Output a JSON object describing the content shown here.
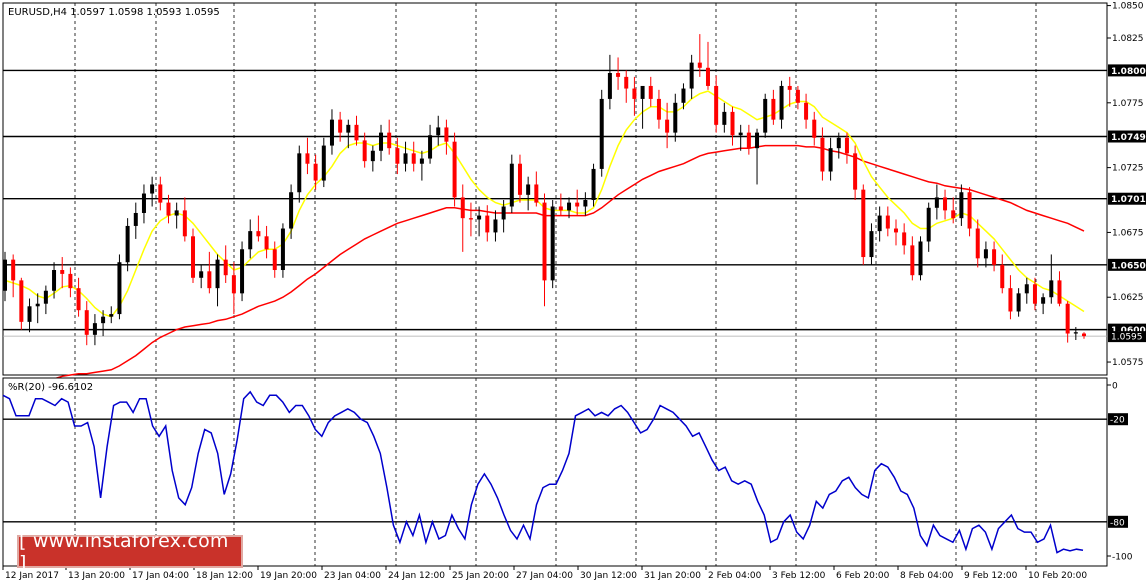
{
  "chart_data": {
    "type": "candlestick",
    "main": {
      "title": "EURUSD,H4  1.0597 1.0598 1.0593 1.0595",
      "ylim": [
        1.0565,
        1.0852
      ],
      "y_ticks": [
        "1.0850",
        "1.0825",
        "1.0775",
        "1.0725",
        "1.0675",
        "1.0625",
        "1.0575"
      ],
      "level_labels": [
        "1.0800",
        "1.0749",
        "1.0701",
        "1.0650",
        "1.0600"
      ],
      "last_price_label": "1.0595",
      "up_color": "#000000",
      "down_color": "#ff0000",
      "ma_fast_color": "#ffff00",
      "ma_slow_color": "#ff0000",
      "candles": [
        [
          1.063,
          1.066,
          1.0622,
          1.0654
        ],
        [
          1.0654,
          1.0658,
          1.0625,
          1.0638
        ],
        [
          1.0638,
          1.064,
          1.06,
          1.0606
        ],
        [
          1.0606,
          1.0624,
          1.0598,
          1.0618
        ],
        [
          1.0618,
          1.0628,
          1.0605,
          1.062
        ],
        [
          1.062,
          1.0634,
          1.0612,
          1.063
        ],
        [
          1.063,
          1.0652,
          1.0624,
          1.0646
        ],
        [
          1.0646,
          1.0656,
          1.0632,
          1.0643
        ],
        [
          1.0643,
          1.0648,
          1.0625,
          1.0632
        ],
        [
          1.0632,
          1.064,
          1.061,
          1.0615
        ],
        [
          1.0615,
          1.0622,
          1.0588,
          1.0596
        ],
        [
          1.0596,
          1.0612,
          1.0588,
          1.0605
        ],
        [
          1.0605,
          1.0615,
          1.0595,
          1.061
        ],
        [
          1.061,
          1.0618,
          1.0605,
          1.0612
        ],
        [
          1.0612,
          1.0658,
          1.0608,
          1.0652
        ],
        [
          1.0652,
          1.0686,
          1.0645,
          1.068
        ],
        [
          1.068,
          1.0698,
          1.067,
          1.069
        ],
        [
          1.069,
          1.0712,
          1.0682,
          1.0705
        ],
        [
          1.0705,
          1.0718,
          1.0695,
          1.0712
        ],
        [
          1.0712,
          1.0718,
          1.0692,
          1.0698
        ],
        [
          1.0698,
          1.0704,
          1.0682,
          1.0688
        ],
        [
          1.0688,
          1.0698,
          1.0678,
          1.0692
        ],
        [
          1.0692,
          1.0702,
          1.0668,
          1.0672
        ],
        [
          1.0672,
          1.0678,
          1.0636,
          1.064
        ],
        [
          1.064,
          1.065,
          1.0632,
          1.0645
        ],
        [
          1.0645,
          1.066,
          1.0628,
          1.0632
        ],
        [
          1.0632,
          1.0658,
          1.0618,
          1.0654
        ],
        [
          1.0654,
          1.0665,
          1.0636,
          1.0642
        ],
        [
          1.0642,
          1.0652,
          1.0612,
          1.0628
        ],
        [
          1.0628,
          1.0668,
          1.0622,
          1.0662
        ],
        [
          1.0662,
          1.0685,
          1.0655,
          1.0676
        ],
        [
          1.0676,
          1.0688,
          1.0668,
          1.0672
        ],
        [
          1.0672,
          1.068,
          1.0655,
          1.0662
        ],
        [
          1.0662,
          1.0668,
          1.064,
          1.0646
        ],
        [
          1.0646,
          1.0682,
          1.064,
          1.0678
        ],
        [
          1.0678,
          1.0712,
          1.067,
          1.0706
        ],
        [
          1.0706,
          1.0742,
          1.0698,
          1.0736
        ],
        [
          1.0736,
          1.0748,
          1.072,
          1.0728
        ],
        [
          1.0728,
          1.0735,
          1.0708,
          1.0715
        ],
        [
          1.0715,
          1.0748,
          1.071,
          1.0742
        ],
        [
          1.0742,
          1.077,
          1.0735,
          1.0762
        ],
        [
          1.0762,
          1.0768,
          1.0745,
          1.0752
        ],
        [
          1.0752,
          1.0762,
          1.074,
          1.0758
        ],
        [
          1.0758,
          1.0765,
          1.0742,
          1.0746
        ],
        [
          1.0746,
          1.0752,
          1.0725,
          1.073
        ],
        [
          1.073,
          1.0742,
          1.0722,
          1.0738
        ],
        [
          1.0738,
          1.0758,
          1.073,
          1.0752
        ],
        [
          1.0752,
          1.0762,
          1.0735,
          1.074
        ],
        [
          1.074,
          1.0748,
          1.072,
          1.0728
        ],
        [
          1.0728,
          1.0745,
          1.0722,
          1.0736
        ],
        [
          1.0736,
          1.0745,
          1.0722,
          1.0728
        ],
        [
          1.0728,
          1.0738,
          1.0715,
          1.0732
        ],
        [
          1.0732,
          1.0758,
          1.0728,
          1.075
        ],
        [
          1.075,
          1.0765,
          1.0742,
          1.0756
        ],
        [
          1.0756,
          1.0762,
          1.0735,
          1.0745
        ],
        [
          1.0745,
          1.0752,
          1.0695,
          1.0702
        ],
        [
          1.0702,
          1.0712,
          1.066,
          1.0686
        ],
        [
          1.0686,
          1.0698,
          1.0672,
          1.0685
        ],
        [
          1.0685,
          1.0695,
          1.0672,
          1.0688
        ],
        [
          1.0688,
          1.0696,
          1.0668,
          1.0675
        ],
        [
          1.0675,
          1.0692,
          1.0668,
          1.0685
        ],
        [
          1.0685,
          1.07,
          1.0675,
          1.0695
        ],
        [
          1.0695,
          1.0735,
          1.069,
          1.0728
        ],
        [
          1.0728,
          1.0735,
          1.0698,
          1.0704
        ],
        [
          1.0704,
          1.0718,
          1.0692,
          1.0712
        ],
        [
          1.0712,
          1.0722,
          1.0695,
          1.0698
        ],
        [
          1.0698,
          1.0705,
          1.0618,
          1.0638
        ],
        [
          1.0638,
          1.07,
          1.0632,
          1.0695
        ],
        [
          1.0695,
          1.0705,
          1.0688,
          1.0692
        ],
        [
          1.0692,
          1.0702,
          1.0686,
          1.0698
        ],
        [
          1.0698,
          1.0708,
          1.0688,
          1.0695
        ],
        [
          1.0695,
          1.0706,
          1.0688,
          1.07
        ],
        [
          1.07,
          1.0728,
          1.0695,
          1.0724
        ],
        [
          1.0724,
          1.0785,
          1.0718,
          1.0778
        ],
        [
          1.0778,
          1.0812,
          1.077,
          1.0798
        ],
        [
          1.0798,
          1.081,
          1.0785,
          1.0795
        ],
        [
          1.0795,
          1.08,
          1.0775,
          1.0786
        ],
        [
          1.0786,
          1.0795,
          1.0765,
          1.0778
        ],
        [
          1.0778,
          1.0785,
          1.0755,
          1.0788
        ],
        [
          1.0788,
          1.0795,
          1.0772,
          1.0778
        ],
        [
          1.0778,
          1.0785,
          1.0755,
          1.0762
        ],
        [
          1.0762,
          1.0775,
          1.074,
          1.0752
        ],
        [
          1.0752,
          1.0782,
          1.0745,
          1.0775
        ],
        [
          1.0775,
          1.079,
          1.077,
          1.0786
        ],
        [
          1.0786,
          1.0812,
          1.0778,
          1.0806
        ],
        [
          1.0806,
          1.0828,
          1.0795,
          1.0802
        ],
        [
          1.0802,
          1.0822,
          1.0785,
          1.0788
        ],
        [
          1.0788,
          1.0796,
          1.0752,
          1.0758
        ],
        [
          1.0758,
          1.0775,
          1.0752,
          1.0768
        ],
        [
          1.0768,
          1.0772,
          1.0742,
          1.075
        ],
        [
          1.075,
          1.0758,
          1.0738,
          1.0752
        ],
        [
          1.0752,
          1.0758,
          1.0735,
          1.074
        ],
        [
          1.074,
          1.0755,
          1.0712,
          1.0752
        ],
        [
          1.0752,
          1.0782,
          1.0748,
          1.0778
        ],
        [
          1.0778,
          1.0785,
          1.0758,
          1.0762
        ],
        [
          1.0762,
          1.0792,
          1.0755,
          1.0788
        ],
        [
          1.0788,
          1.0795,
          1.0772,
          1.0785
        ],
        [
          1.0785,
          1.0788,
          1.077,
          1.0775
        ],
        [
          1.0775,
          1.0782,
          1.0755,
          1.0762
        ],
        [
          1.0762,
          1.0768,
          1.0742,
          1.0748
        ],
        [
          1.0748,
          1.0756,
          1.0715,
          1.0722
        ],
        [
          1.0722,
          1.0748,
          1.0715,
          1.074
        ],
        [
          1.074,
          1.0752,
          1.0732,
          1.0748
        ],
        [
          1.0748,
          1.0752,
          1.0728,
          1.0736
        ],
        [
          1.0736,
          1.0742,
          1.07,
          1.0708
        ],
        [
          1.0708,
          1.0712,
          1.065,
          1.0656
        ],
        [
          1.0656,
          1.0682,
          1.065,
          1.0676
        ],
        [
          1.0676,
          1.0695,
          1.0668,
          1.0688
        ],
        [
          1.0688,
          1.0695,
          1.0672,
          1.0678
        ],
        [
          1.0678,
          1.0685,
          1.0665,
          1.0675
        ],
        [
          1.0675,
          1.0682,
          1.0658,
          1.0665
        ],
        [
          1.0665,
          1.0672,
          1.0638,
          1.0642
        ],
        [
          1.0642,
          1.0672,
          1.0638,
          1.0668
        ],
        [
          1.0668,
          1.0698,
          1.066,
          1.0694
        ],
        [
          1.0694,
          1.0712,
          1.0685,
          1.0702
        ],
        [
          1.0702,
          1.0708,
          1.0685,
          1.0692
        ],
        [
          1.0692,
          1.0702,
          1.0682,
          1.0686
        ],
        [
          1.0686,
          1.0712,
          1.068,
          1.0706
        ],
        [
          1.0706,
          1.071,
          1.0672,
          1.0678
        ],
        [
          1.0678,
          1.0685,
          1.0648,
          1.0655
        ],
        [
          1.0655,
          1.0668,
          1.0648,
          1.0662
        ],
        [
          1.0662,
          1.0668,
          1.0645,
          1.065
        ],
        [
          1.065,
          1.0658,
          1.0628,
          1.0632
        ],
        [
          1.0632,
          1.0642,
          1.0608,
          1.0614
        ],
        [
          1.0614,
          1.0632,
          1.061,
          1.0628
        ],
        [
          1.0628,
          1.064,
          1.062,
          1.0635
        ],
        [
          1.0635,
          1.064,
          1.0615,
          1.062
        ],
        [
          1.062,
          1.0628,
          1.0612,
          1.0625
        ],
        [
          1.0625,
          1.0658,
          1.062,
          1.0638
        ],
        [
          1.0638,
          1.0645,
          1.0618,
          1.062
        ],
        [
          1.062,
          1.0622,
          1.059,
          1.0597
        ],
        [
          1.0597,
          1.0602,
          1.0592,
          1.0598
        ],
        [
          1.0597,
          1.0598,
          1.0593,
          1.0595
        ]
      ],
      "ma_fast": [
        1.0638,
        1.0636,
        1.0634,
        1.0631,
        1.0626,
        1.0624,
        1.0628,
        1.0633,
        1.0634,
        1.063,
        1.0624,
        1.0617,
        1.0612,
        1.061,
        1.0618,
        1.063,
        1.0646,
        1.0662,
        1.0676,
        1.0684,
        1.0688,
        1.069,
        1.0688,
        1.0682,
        1.0674,
        1.0666,
        1.0658,
        1.0652,
        1.0646,
        1.0648,
        1.0654,
        1.066,
        1.0662,
        1.0662,
        1.0666,
        1.0676,
        1.0692,
        1.0704,
        1.0712,
        1.0718,
        1.0726,
        1.0736,
        1.0742,
        1.0744,
        1.0744,
        1.0742,
        1.0744,
        1.0744,
        1.0742,
        1.074,
        1.0738,
        1.0736,
        1.0738,
        1.0742,
        1.0744,
        1.0736,
        1.0726,
        1.0716,
        1.0708,
        1.0702,
        1.0698,
        1.0696,
        1.0698,
        1.07,
        1.07,
        1.07,
        1.0694,
        1.0692,
        1.0692,
        1.0692,
        1.069,
        1.069,
        1.0694,
        1.0708,
        1.0726,
        1.0742,
        1.0754,
        1.0762,
        1.0768,
        1.0772,
        1.0772,
        1.0768,
        1.0768,
        1.0772,
        1.0778,
        1.0782,
        1.0784,
        1.078,
        1.0776,
        1.0772,
        1.077,
        1.0766,
        1.0762,
        1.0764,
        1.0766,
        1.077,
        1.0774,
        1.0776,
        1.0776,
        1.0772,
        1.0764,
        1.076,
        1.0756,
        1.0752,
        1.0744,
        1.073,
        1.0718,
        1.071,
        1.0702,
        1.0696,
        1.069,
        1.0682,
        1.0678,
        1.0678,
        1.0682,
        1.0684,
        1.0686,
        1.069,
        1.0688,
        1.0682,
        1.0676,
        1.067,
        1.0662,
        1.0654,
        1.0646,
        1.064,
        1.0636,
        1.0632,
        1.063,
        1.0626,
        1.0622,
        1.0618,
        1.0614
      ],
      "ma_slow": [
        1.0555,
        1.0556,
        1.0557,
        1.0558,
        1.0559,
        1.056,
        1.0562,
        1.0564,
        1.0565,
        1.0566,
        1.0566,
        1.0567,
        1.0568,
        1.0569,
        1.0572,
        1.0576,
        1.058,
        1.0585,
        1.059,
        1.0594,
        1.0597,
        1.06,
        1.0602,
        1.0603,
        1.0604,
        1.0605,
        1.0607,
        1.0608,
        1.061,
        1.0612,
        1.0615,
        1.0618,
        1.062,
        1.0622,
        1.0625,
        1.0629,
        1.0634,
        1.0639,
        1.0643,
        1.0648,
        1.0653,
        1.0658,
        1.0662,
        1.0666,
        1.067,
        1.0673,
        1.0676,
        1.0679,
        1.0682,
        1.0684,
        1.0686,
        1.0688,
        1.069,
        1.0692,
        1.0694,
        1.0694,
        1.0693,
        1.0692,
        1.0692,
        1.0691,
        1.069,
        1.069,
        1.069,
        1.069,
        1.069,
        1.069,
        1.0688,
        1.0688,
        1.0688,
        1.0688,
        1.0688,
        1.0688,
        1.069,
        1.0694,
        1.0699,
        1.0704,
        1.0708,
        1.0712,
        1.0716,
        1.0719,
        1.0722,
        1.0724,
        1.0726,
        1.0728,
        1.0731,
        1.0734,
        1.0736,
        1.0737,
        1.0738,
        1.0739,
        1.074,
        1.074,
        1.0741,
        1.0742,
        1.0742,
        1.0742,
        1.0742,
        1.0742,
        1.0741,
        1.0741,
        1.074,
        1.0738,
        1.0737,
        1.0735,
        1.0733,
        1.073,
        1.0728,
        1.0726,
        1.0724,
        1.0722,
        1.072,
        1.0718,
        1.0716,
        1.0714,
        1.0713,
        1.0711,
        1.071,
        1.0709,
        1.0708,
        1.0706,
        1.0704,
        1.0702,
        1.07,
        1.0698,
        1.0695,
        1.0692,
        1.069,
        1.0688,
        1.0686,
        1.0684,
        1.0682,
        1.0679,
        1.0676
      ]
    },
    "indicator": {
      "title": "%R(20) -96.6102",
      "ylim": [
        -100,
        0
      ],
      "y_ticks": [
        "0",
        "-20",
        "-80",
        "-100"
      ],
      "line_color": "#0000cc",
      "values": [
        -6,
        -8,
        -18,
        -18,
        -18,
        -8,
        -8,
        -10,
        -12,
        -8,
        -10,
        -24,
        -24,
        -22,
        -36,
        -66,
        -36,
        -12,
        -10,
        -10,
        -16,
        -8,
        -8,
        -24,
        -30,
        -24,
        -50,
        -66,
        -70,
        -60,
        -40,
        -26,
        -28,
        -40,
        -64,
        -52,
        -32,
        -8,
        -4,
        -10,
        -12,
        -6,
        -6,
        -10,
        -16,
        -12,
        -12,
        -18,
        -26,
        -30,
        -22,
        -18,
        -16,
        -14,
        -16,
        -20,
        -22,
        -30,
        -40,
        -60,
        -82,
        -92,
        -80,
        -88,
        -76,
        -92,
        -80,
        -90,
        -88,
        -76,
        -84,
        -90,
        -70,
        -58,
        -52,
        -58,
        -66,
        -76,
        -85,
        -90,
        -82,
        -90,
        -70,
        -60,
        -58,
        -58,
        -50,
        -40,
        -18,
        -16,
        -14,
        -18,
        -16,
        -18,
        -14,
        -12,
        -16,
        -22,
        -28,
        -26,
        -20,
        -12,
        -14,
        -16,
        -20,
        -24,
        -30,
        -28,
        -36,
        -44,
        -50,
        -48,
        -56,
        -58,
        -56,
        -58,
        -68,
        -76,
        -92,
        -90,
        -80,
        -76,
        -86,
        -90,
        -82,
        -68,
        -72,
        -64,
        -62,
        -56,
        -54,
        -60,
        -64,
        -66,
        -50,
        -46,
        -48,
        -54,
        -62,
        -64,
        -72,
        -88,
        -94,
        -82,
        -88,
        -90,
        -92,
        -85,
        -96,
        -84,
        -82,
        -86,
        -96,
        -84,
        -80,
        -76,
        -84,
        -86,
        -86,
        -92,
        -90,
        -82,
        -98,
        -96,
        -97,
        -96,
        -96.6
      ]
    },
    "x_tick_labels": [
      "12 Jan 2017",
      "13 Jan 20:00",
      "17 Jan 04:00",
      "18 Jan 12:00",
      "19 Jan 20:00",
      "23 Jan 04:00",
      "24 Jan 12:00",
      "25 Jan 20:00",
      "27 Jan 04:00",
      "30 Jan 12:00",
      "31 Jan 20:00",
      "2 Feb 04:00",
      "3 Feb 12:00",
      "6 Feb 20:00",
      "8 Feb 04:00",
      "9 Feb 12:00",
      "10 Feb 20:00"
    ]
  },
  "watermark": {
    "text": "[ www.instaforex.com ]"
  }
}
